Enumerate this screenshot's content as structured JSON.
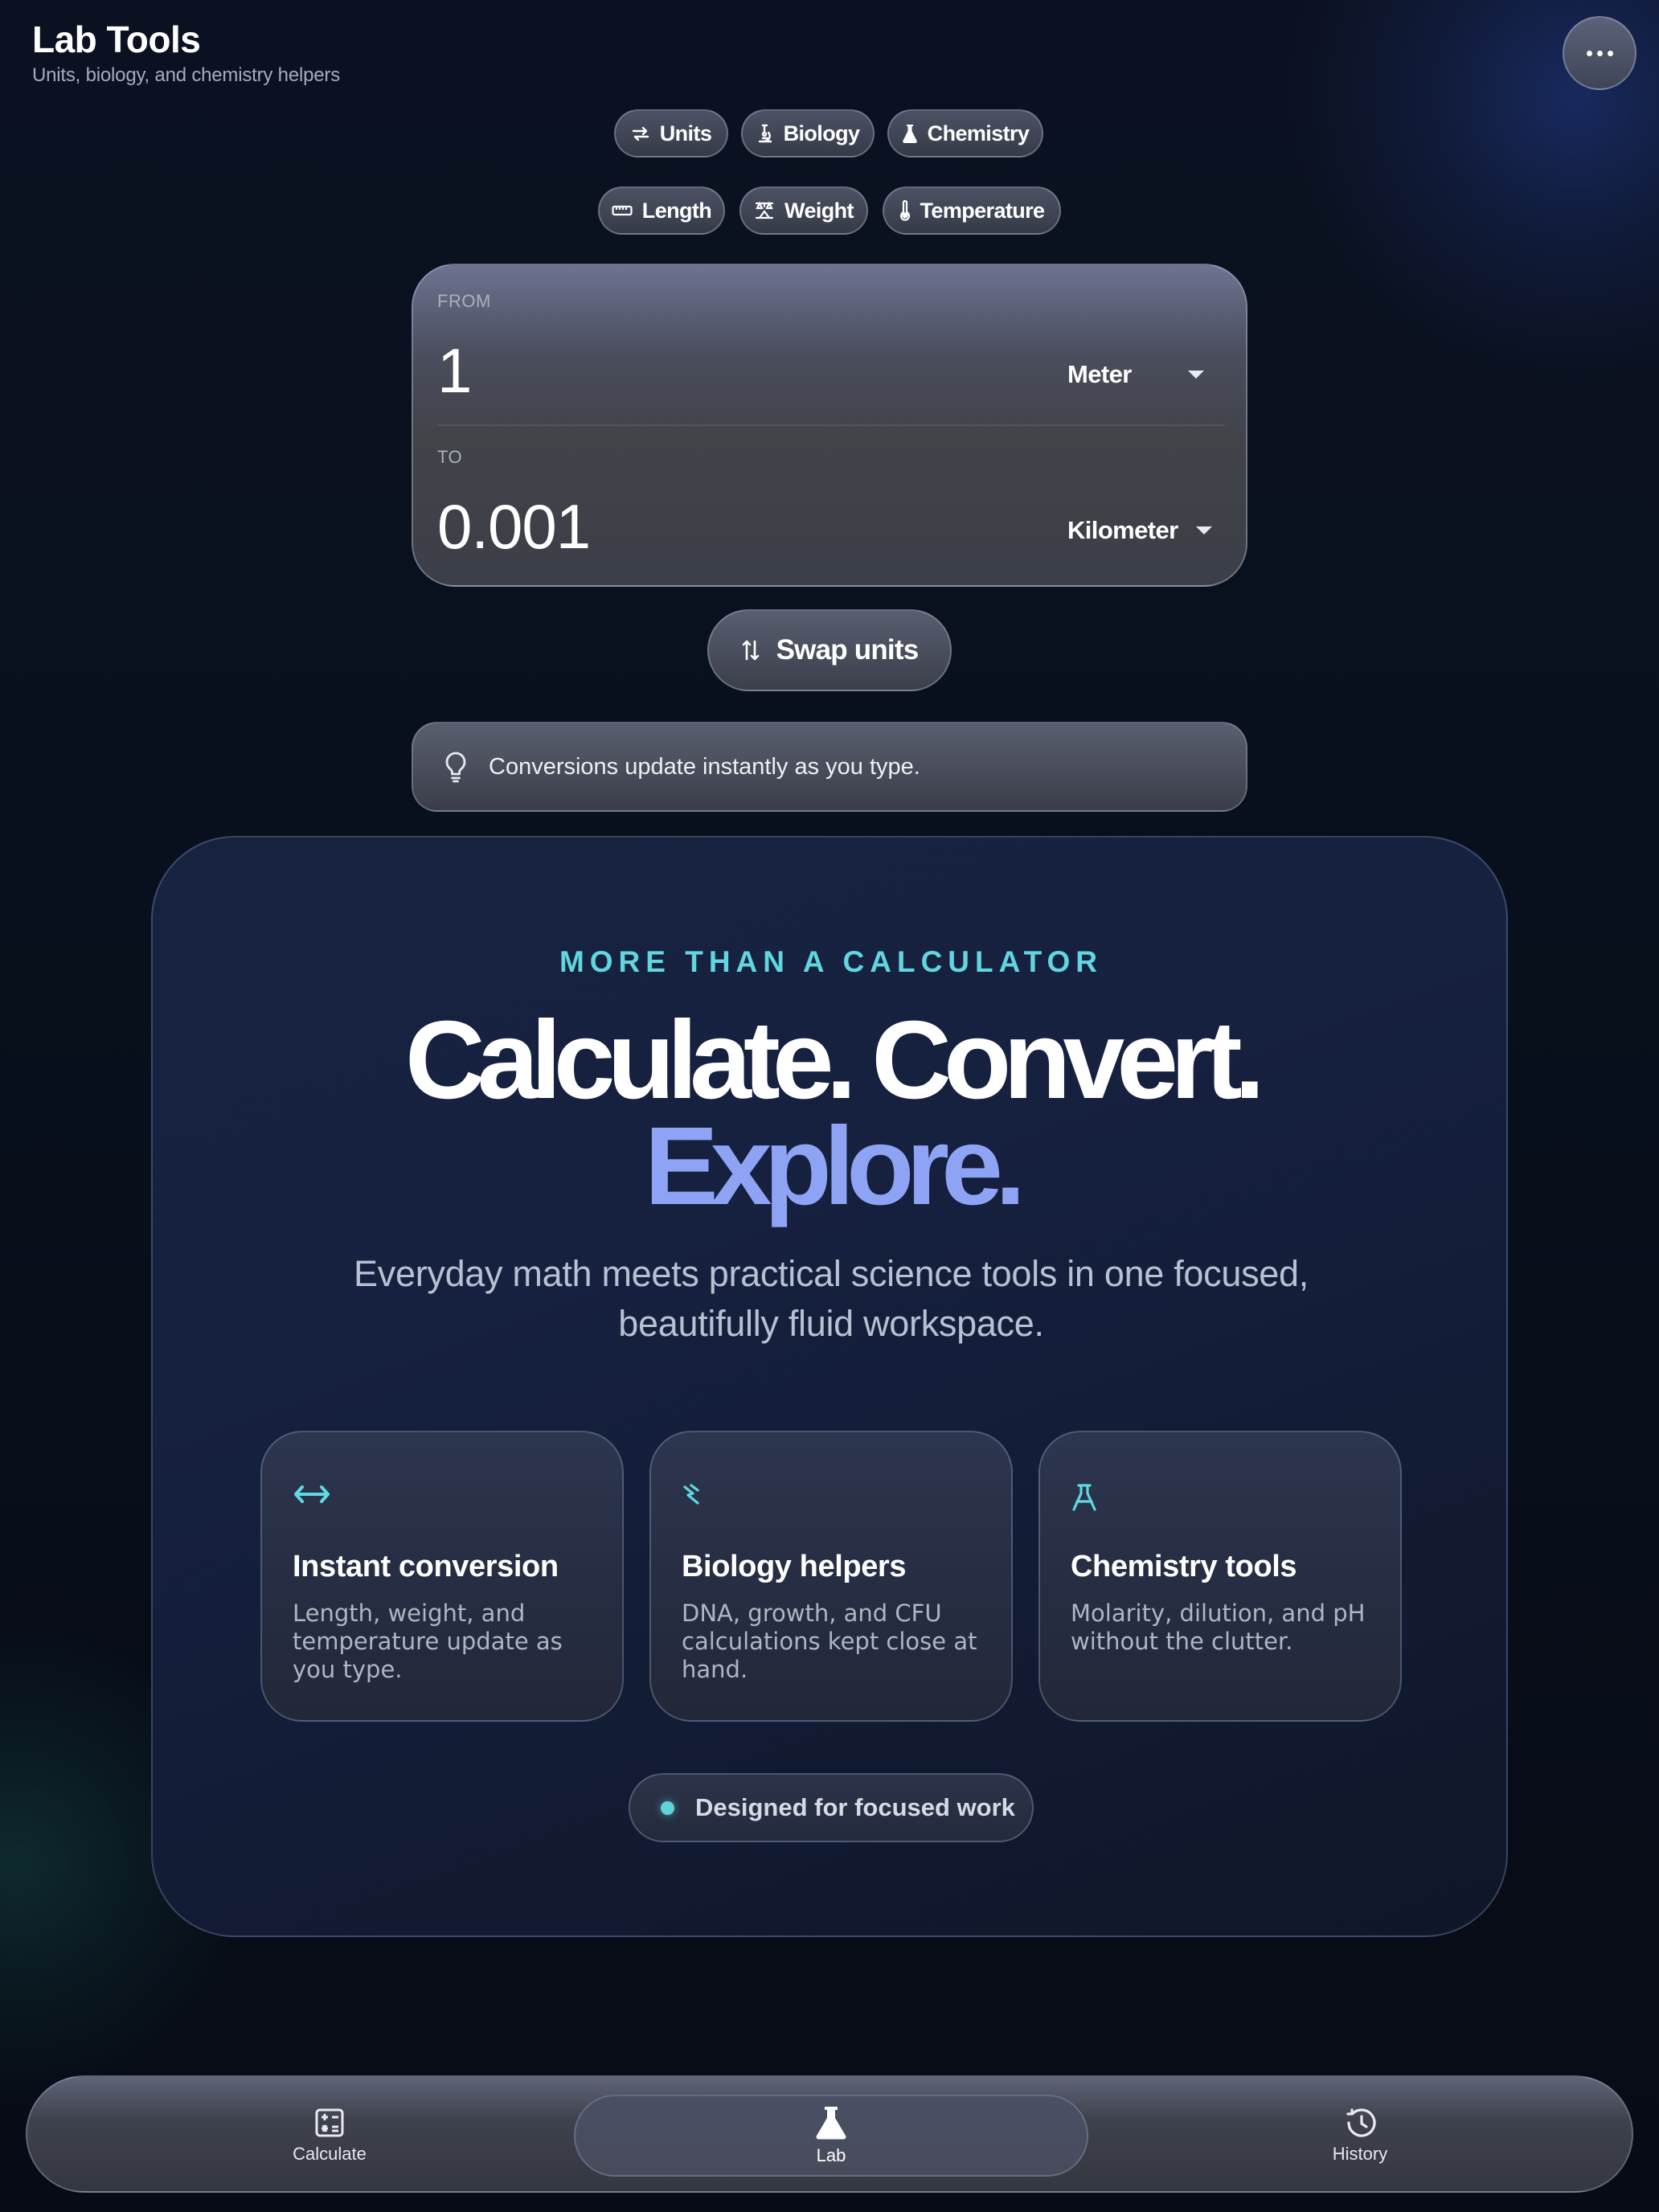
{
  "header": {
    "title": "Lab Tools",
    "subtitle": "Units, biology, and chemistry helpers",
    "more_icon": "more-horizontal-icon"
  },
  "tool_tabs": [
    {
      "label": "Units",
      "icon": "swap-arrows-icon",
      "active": true
    },
    {
      "label": "Biology",
      "icon": "microscope-icon",
      "active": false
    },
    {
      "label": "Chemistry",
      "icon": "flask-icon",
      "active": false
    }
  ],
  "unit_tabs": [
    {
      "label": "Length",
      "icon": "ruler-icon",
      "active": true
    },
    {
      "label": "Weight",
      "icon": "scale-icon",
      "active": false
    },
    {
      "label": "Temperature",
      "icon": "thermometer-icon",
      "active": false
    }
  ],
  "converter": {
    "from_label": "FROM",
    "from_value": "1",
    "from_unit": "Meter",
    "to_label": "TO",
    "to_value": "0.001",
    "to_unit": "Kilometer"
  },
  "swap_button": {
    "label": "Swap units",
    "icon": "swap-vertical-icon"
  },
  "tip": {
    "text": "Conversions update instantly as you type.",
    "icon": "lightbulb-icon"
  },
  "hero": {
    "kicker": "MORE THAN A CALCULATOR",
    "headline_line1": "Calculate. Convert.",
    "headline_line2": "Explore.",
    "description": "Everyday math meets practical science tools in one focused, beautifully fluid workspace.",
    "features": [
      {
        "title": "Instant conversion",
        "description": "Length, weight, and temperature update as you type.",
        "icon": "arrows-horizontal-icon"
      },
      {
        "title": "Biology helpers",
        "description": "DNA, growth, and CFU calculations kept close at hand.",
        "icon": "dna-icon"
      },
      {
        "title": "Chemistry tools",
        "description": "Molarity, dilution, and pH without the clutter.",
        "icon": "flask-glyph-icon"
      }
    ],
    "pill_label": "Designed for focused work"
  },
  "bottom_nav": [
    {
      "label": "Calculate",
      "icon": "calculator-icon",
      "active": false
    },
    {
      "label": "Lab",
      "icon": "flask-icon",
      "active": true
    },
    {
      "label": "History",
      "icon": "history-icon",
      "active": false
    }
  ],
  "colors": {
    "accent_cyan": "#62d6e0",
    "accent_blue": "#8ea3f4",
    "background": "#070b15"
  }
}
